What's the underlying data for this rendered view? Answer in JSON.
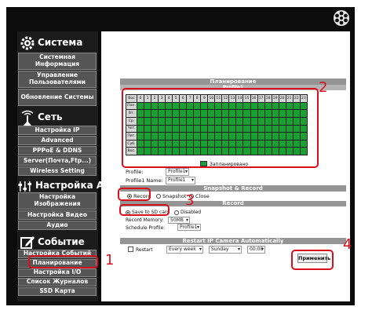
{
  "sidebar": {
    "system": {
      "title": "Система",
      "items": [
        "Системная Информация",
        "Управление Пользователями",
        "Обновление Системы"
      ]
    },
    "network": {
      "title": "Сеть",
      "items": [
        "Настройка IP",
        "Advanced",
        "PPPoE & DDNS",
        "Server(Почта,Ftp...)",
        "Wireless Setting"
      ]
    },
    "av": {
      "title": "Настройка A/V",
      "items": [
        "Настройка Изображения",
        "Настройка Видео",
        "Аудио"
      ]
    },
    "event": {
      "title": "Событие",
      "items": [
        "Настройка Событий",
        "Планирование",
        "Настройка I/O",
        "Список Журналов",
        "SSD Карта"
      ]
    }
  },
  "schedule": {
    "title": "Планирование",
    "subtitle": "Profile1",
    "corner": "Вос",
    "hours": [
      "0",
      "1",
      "2",
      "3",
      "4",
      "5",
      "6",
      "7",
      "8",
      "9",
      "10",
      "11",
      "12",
      "13",
      "14",
      "15",
      "16",
      "17",
      "18",
      "19",
      "20",
      "21",
      "22",
      "23"
    ],
    "days": [
      "Пон.",
      "Вт.",
      "Ср.",
      "Чет.",
      "Пят.",
      "Суб.",
      "Вос."
    ],
    "legend": "Запланировано",
    "legend_color": "#1aa032",
    "profile_label": "Profile:",
    "profile_value": "Profile1",
    "name_label": "Profile1 Name:",
    "name_value": "Profile1"
  },
  "snapshot": {
    "title": "Snapshot & Record",
    "options": [
      "Record",
      "Snapshot",
      "Close"
    ]
  },
  "record": {
    "title": "Record",
    "options": [
      "Save to SD card",
      "Disabled"
    ],
    "memory_label": "Record Memory:",
    "memory_value": "50MB",
    "schedule_label": "Schedule Profile:",
    "schedule_value": "Profile1"
  },
  "restart": {
    "title": "Restart IP Camera Automatically",
    "checkbox_label": "Restart",
    "frequency": "Every week",
    "day": "Sunday",
    "time": "00:00"
  },
  "apply_label": "Применить",
  "annotations": [
    "1",
    "2",
    "3",
    "4"
  ],
  "colors": {
    "annotation": "#d8101c",
    "scheduled": "#1aa032",
    "section_bar": "#959595"
  }
}
